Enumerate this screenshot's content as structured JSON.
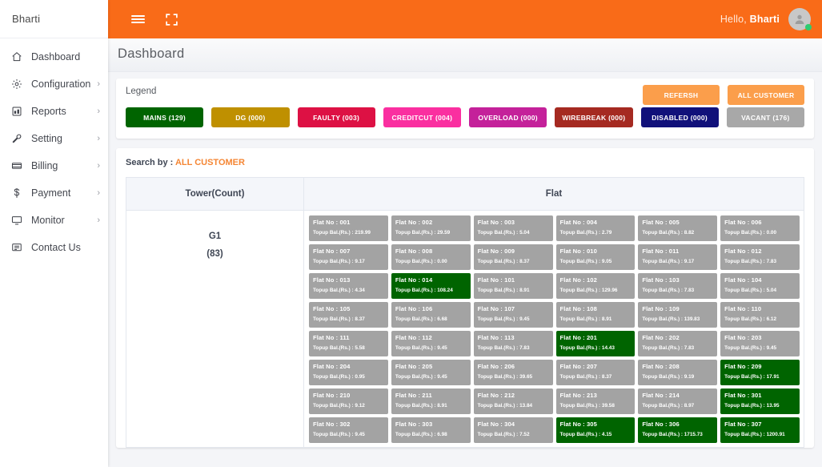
{
  "brand": {
    "name": "Bharti"
  },
  "topbar": {
    "menu_icon": "hamburger-icon",
    "fullscreen_icon": "fullscreen-icon",
    "greeting_prefix": "Hello,",
    "user_name": "Bharti",
    "avatar_icon": "user-avatar-icon"
  },
  "page": {
    "title": "Dashboard"
  },
  "sidebar": {
    "items": [
      {
        "label": "Dashboard",
        "icon": "home-icon",
        "caret": ""
      },
      {
        "label": "Configuration",
        "icon": "gear-icon",
        "caret": "›"
      },
      {
        "label": "Reports",
        "icon": "report-icon",
        "caret": "›"
      },
      {
        "label": "Setting",
        "icon": "wrench-icon",
        "caret": "›"
      },
      {
        "label": "Billing",
        "icon": "billing-icon",
        "caret": "›"
      },
      {
        "label": "Payment",
        "icon": "dollar-icon",
        "caret": "›"
      },
      {
        "label": "Monitor",
        "icon": "monitor-icon",
        "caret": "›"
      },
      {
        "label": "Contact Us",
        "icon": "contact-icon",
        "caret": ""
      }
    ]
  },
  "legend": {
    "title": "Legend",
    "refresh_label": "REFERSH",
    "all_customer_label": "ALL CUSTOMER",
    "action_color": "#fb9e4b",
    "items": [
      {
        "label": "MAINS (129)",
        "color": "#006400"
      },
      {
        "label": "DG (000)",
        "color": "#bf9000"
      },
      {
        "label": "FAULTY (003)",
        "color": "#dd1144"
      },
      {
        "label": "CREDITCUT (004)",
        "color": "#fa2fa0"
      },
      {
        "label": "OVERLOAD (000)",
        "color": "#c4219a"
      },
      {
        "label": "WIREBREAK (000)",
        "color": "#a52a21"
      },
      {
        "label": "DISABLED (000)",
        "color": "#11117a"
      },
      {
        "label": "VACANT (176)",
        "color": "#a8a8a8"
      }
    ]
  },
  "search": {
    "prefix": "Search by :",
    "value": "ALL CUSTOMER"
  },
  "table": {
    "headers": {
      "tower": "Tower(Count)",
      "flat": "Flat"
    },
    "tower": {
      "name": "G1",
      "count": "(83)"
    },
    "flat_label_prefix": "Flat No : ",
    "balance_label_prefix": "Topup Bal.(Rs.) : ",
    "flats": [
      {
        "no": "001",
        "bal": "219.99",
        "status": "vacant"
      },
      {
        "no": "002",
        "bal": "29.59",
        "status": "vacant"
      },
      {
        "no": "003",
        "bal": "5.04",
        "status": "vacant"
      },
      {
        "no": "004",
        "bal": "2.79",
        "status": "vacant"
      },
      {
        "no": "005",
        "bal": "8.82",
        "status": "vacant"
      },
      {
        "no": "006",
        "bal": "0.00",
        "status": "vacant"
      },
      {
        "no": "007",
        "bal": "9.17",
        "status": "vacant"
      },
      {
        "no": "008",
        "bal": "0.00",
        "status": "vacant"
      },
      {
        "no": "009",
        "bal": "8.37",
        "status": "vacant"
      },
      {
        "no": "010",
        "bal": "9.05",
        "status": "vacant"
      },
      {
        "no": "011",
        "bal": "9.17",
        "status": "vacant"
      },
      {
        "no": "012",
        "bal": "7.83",
        "status": "vacant"
      },
      {
        "no": "013",
        "bal": "4.34",
        "status": "vacant"
      },
      {
        "no": "014",
        "bal": "108.24",
        "status": "mains"
      },
      {
        "no": "101",
        "bal": "8.91",
        "status": "vacant"
      },
      {
        "no": "102",
        "bal": "129.96",
        "status": "vacant"
      },
      {
        "no": "103",
        "bal": "7.83",
        "status": "vacant"
      },
      {
        "no": "104",
        "bal": "5.04",
        "status": "vacant"
      },
      {
        "no": "105",
        "bal": "8.37",
        "status": "vacant"
      },
      {
        "no": "106",
        "bal": "6.68",
        "status": "vacant"
      },
      {
        "no": "107",
        "bal": "9.45",
        "status": "vacant"
      },
      {
        "no": "108",
        "bal": "8.91",
        "status": "vacant"
      },
      {
        "no": "109",
        "bal": "139.83",
        "status": "vacant"
      },
      {
        "no": "110",
        "bal": "6.12",
        "status": "vacant"
      },
      {
        "no": "111",
        "bal": "5.58",
        "status": "vacant"
      },
      {
        "no": "112",
        "bal": "9.45",
        "status": "vacant"
      },
      {
        "no": "113",
        "bal": "7.83",
        "status": "vacant"
      },
      {
        "no": "201",
        "bal": "14.43",
        "status": "mains"
      },
      {
        "no": "202",
        "bal": "7.83",
        "status": "vacant"
      },
      {
        "no": "203",
        "bal": "9.45",
        "status": "vacant"
      },
      {
        "no": "204",
        "bal": "0.95",
        "status": "vacant"
      },
      {
        "no": "205",
        "bal": "9.45",
        "status": "vacant"
      },
      {
        "no": "206",
        "bal": "39.65",
        "status": "vacant"
      },
      {
        "no": "207",
        "bal": "8.37",
        "status": "vacant"
      },
      {
        "no": "208",
        "bal": "9.19",
        "status": "vacant"
      },
      {
        "no": "209",
        "bal": "17.91",
        "status": "mains"
      },
      {
        "no": "210",
        "bal": "9.12",
        "status": "vacant"
      },
      {
        "no": "211",
        "bal": "8.91",
        "status": "vacant"
      },
      {
        "no": "212",
        "bal": "13.84",
        "status": "vacant"
      },
      {
        "no": "213",
        "bal": "39.58",
        "status": "vacant"
      },
      {
        "no": "214",
        "bal": "8.97",
        "status": "vacant"
      },
      {
        "no": "301",
        "bal": "13.95",
        "status": "mains"
      },
      {
        "no": "302",
        "bal": "9.45",
        "status": "vacant"
      },
      {
        "no": "303",
        "bal": "6.98",
        "status": "vacant"
      },
      {
        "no": "304",
        "bal": "7.52",
        "status": "vacant"
      },
      {
        "no": "305",
        "bal": "4.15",
        "status": "mains"
      },
      {
        "no": "306",
        "bal": "1715.73",
        "status": "mains"
      },
      {
        "no": "307",
        "bal": "1200.91",
        "status": "mains"
      }
    ]
  }
}
